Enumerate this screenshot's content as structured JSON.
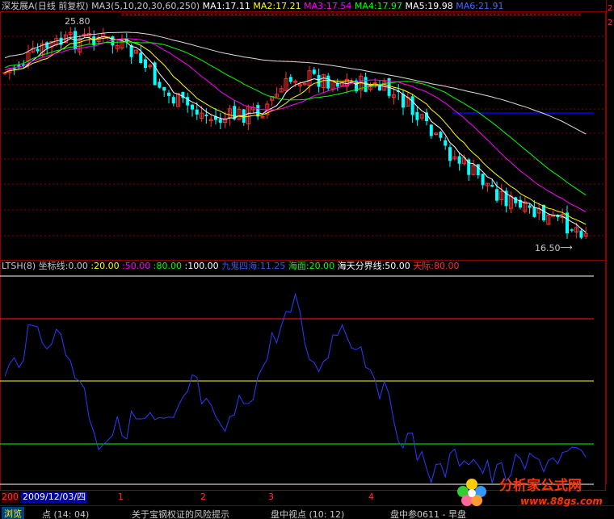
{
  "header": {
    "stock_name": "深发展A(日线 前复权)",
    "ma_params": "MA3(5,10,20,30,60,250)",
    "ma1": "MA1:17.11",
    "ma2": "MA2:17.21",
    "ma3": "MA3:17.54",
    "ma4": "MA4:17.97",
    "ma5": "MA5:19.98",
    "ma6": "MA6:21.91",
    "colors": {
      "ma1": "#ffffff",
      "ma2": "#ffff00",
      "ma3": "#ff00ff",
      "ma4": "#00ff00",
      "ma5": "#ffffff",
      "ma6": "#0000ff"
    }
  },
  "price_panel": {
    "high_label": "25.80",
    "low_label": "16.50",
    "candle_up_color": "#ff3030",
    "candle_down_color": "#00ffff"
  },
  "indicator_panel": {
    "name": "LTSH(8)",
    "coord_label": "坐标线:0.00",
    "levels": [
      ":20.00",
      ":50.00",
      ":80.00",
      ":100.00"
    ],
    "level_colors": [
      "#ffff00",
      "#ff00ff",
      "#00ff00",
      "#ffffff"
    ],
    "ninenine": "九鬼四海:11.25",
    "sea": "海面:20.00",
    "boundary": "海天分界线:50.00",
    "sky": "天际:80.00"
  },
  "date_axis": {
    "year_label": "200",
    "date_label": "2009/12/03/四",
    "months": [
      "1",
      "2",
      "3",
      "4"
    ]
  },
  "ticker": {
    "tab": "浏览",
    "items": [
      "点 (14: 04)",
      "关于宝钢权证的风险提示",
      "盘中视点 (10: 12)",
      "盘中参0611 - 早盘"
    ]
  },
  "logo": {
    "text": "分析家公式网",
    "url": "www.88gs.com"
  }
}
